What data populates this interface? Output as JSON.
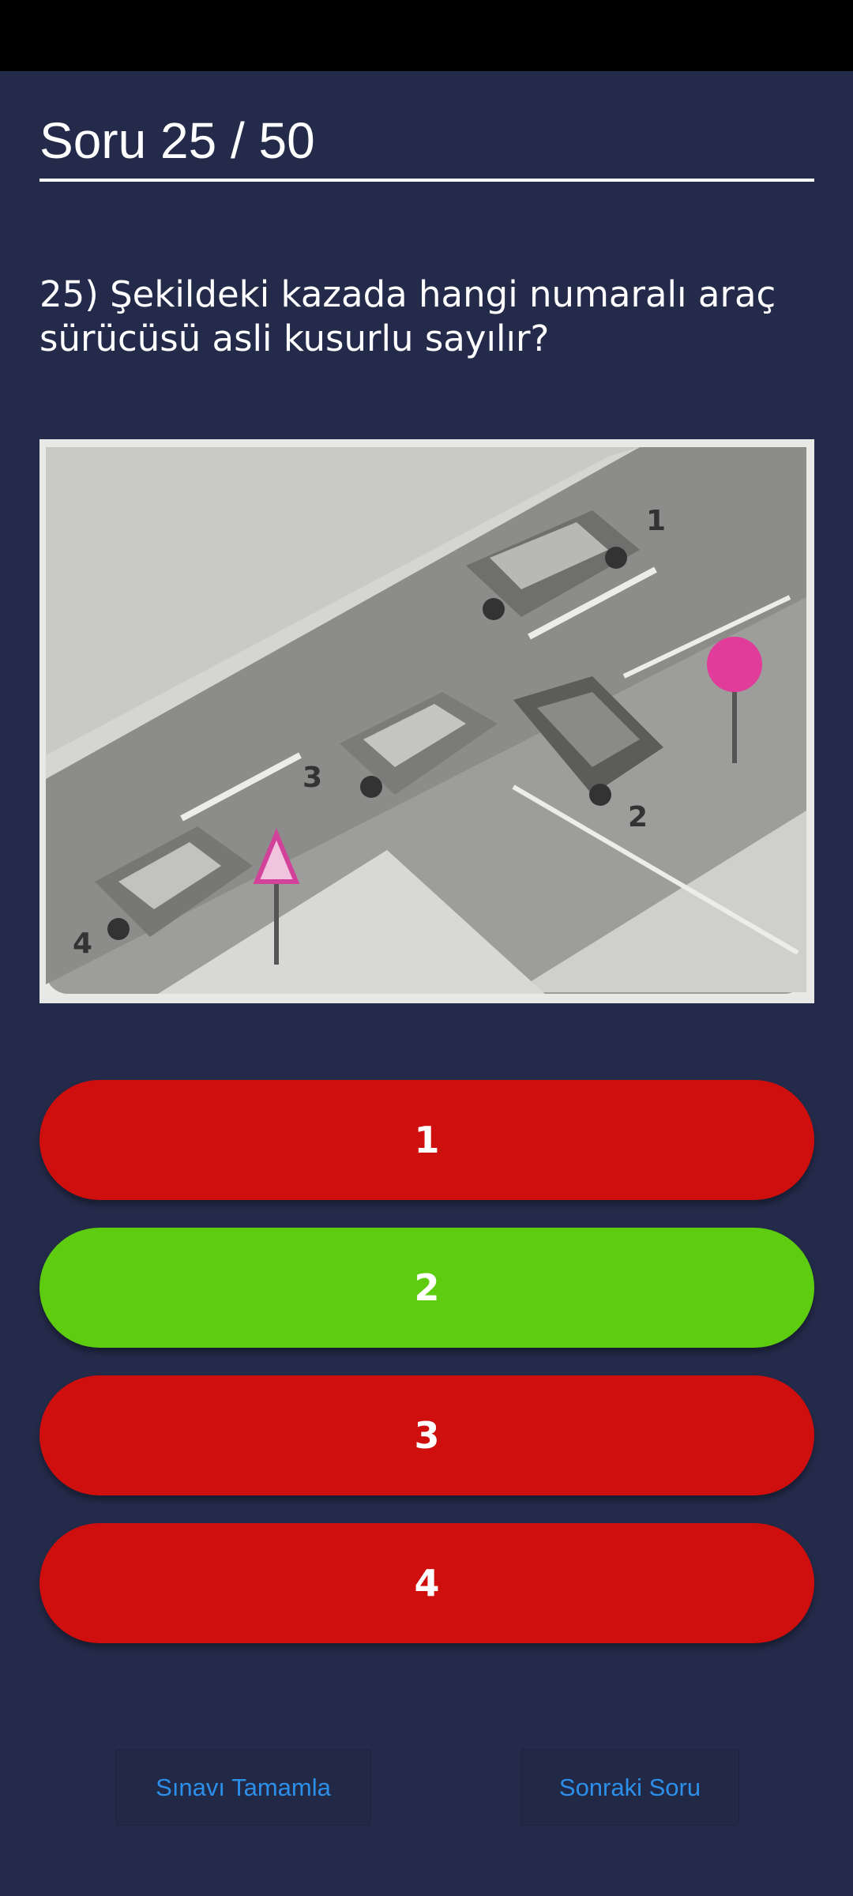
{
  "header": {
    "title": "Soru 25 / 50"
  },
  "question": {
    "text": "25) Şekildeki kazada hangi numaralı araç sürücüsü asli kusurlu sayılır?",
    "image_icon": "traffic-accident-illustration"
  },
  "answers": [
    {
      "label": "1",
      "color": "#cf0e0e",
      "state": "wrong"
    },
    {
      "label": "2",
      "color": "#5ecd10",
      "state": "correct"
    },
    {
      "label": "3",
      "color": "#cf0e0e",
      "state": "wrong"
    },
    {
      "label": "4",
      "color": "#cf0e0e",
      "state": "wrong"
    }
  ],
  "footer": {
    "finish_label": "Sınavı Tamamla",
    "next_label": "Sonraki Soru"
  },
  "colors": {
    "background": "#242b4a",
    "status_bar": "#000000",
    "link": "#2c8fe9"
  }
}
